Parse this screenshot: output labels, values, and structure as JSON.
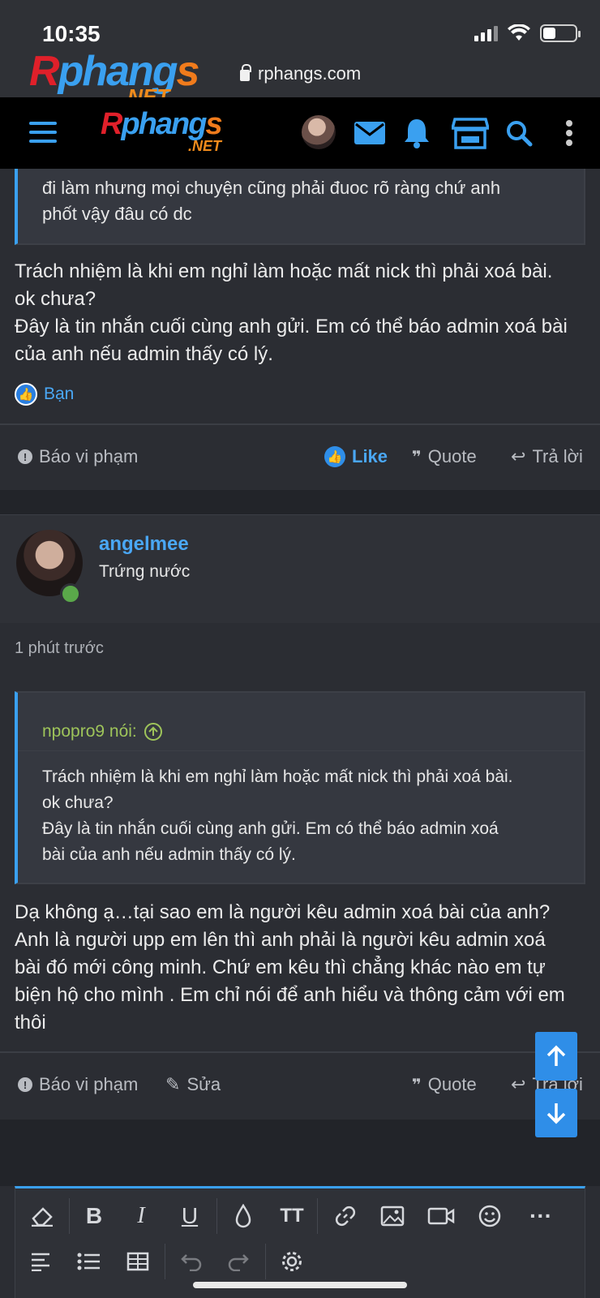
{
  "status_bar": {
    "time": "10:35"
  },
  "browser": {
    "url": "rphangs.com"
  },
  "logo": {
    "brand_r": "R",
    "brand_rest": "phang",
    "brand_s": "s",
    "brand_net": ".NET"
  },
  "header_icons": [
    "menu-icon",
    "avatar",
    "mail-icon",
    "bell-icon",
    "store-icon",
    "search-icon",
    "more-vertical-icon"
  ],
  "post1": {
    "quote_lines": [
      "đi làm nhưng mọi chuyện cũng phải đuoc rõ ràng chứ anh",
      "phốt vậy đâu có dc"
    ],
    "body_lines": [
      "Trách nhiệm là khi em nghỉ làm hoặc mất nick thì phải xoá bài.",
      "ok chưa?",
      "Đây là tin nhắn cuối cùng anh gửi. Em có thể báo admin xoá bài",
      "của anh nếu admin thấy có lý."
    ],
    "reaction_user": "Bạn",
    "actions": {
      "report": "Báo vi phạm",
      "like": "Like",
      "quote": "Quote",
      "reply": "Trả lời"
    }
  },
  "post2": {
    "username": "angelmee",
    "user_title": "Trứng nước",
    "time": "1 phút trước",
    "quote_author": "npopro9 nói:",
    "quote_lines": [
      "Trách nhiệm là khi em nghỉ làm hoặc mất nick thì phải xoá bài.",
      "ok chưa?",
      "Đây là tin nhắn cuối cùng anh gửi. Em có thể báo admin xoá",
      "bài của anh nếu admin thấy có lý."
    ],
    "body_lines": [
      "Dạ không ạ…tại sao em là người kêu admin xoá bài của anh?",
      "Anh là người upp em lên thì anh phải là người kêu admin xoá",
      "bài đó mới công minh. Chứ em kêu thì chẳng khác nào em tự",
      "biện hộ cho mình . Em chỉ nói để anh hiểu và thông cảm với em",
      "thôi"
    ],
    "actions": {
      "report": "Báo vi phạm",
      "edit": "Sửa",
      "quote": "Quote",
      "reply": "Trả lời"
    }
  },
  "editor_tools": {
    "row1": [
      "eraser-icon",
      "bold-icon",
      "italic-icon",
      "underline-icon",
      "color-icon",
      "text-size-icon",
      "link-icon",
      "image-icon",
      "video-icon",
      "emoji-icon",
      "more-icon"
    ],
    "row2": [
      "align-icon",
      "list-icon",
      "table-icon",
      "undo-icon",
      "redo-icon",
      "settings-icon"
    ],
    "bold": "B",
    "italic": "I",
    "underline": "U",
    "text_size": "TT",
    "more": "···"
  },
  "colors": {
    "accent": "#3aa0f0",
    "bg": "#2b2d33",
    "quote_author": "#9ec45a"
  }
}
